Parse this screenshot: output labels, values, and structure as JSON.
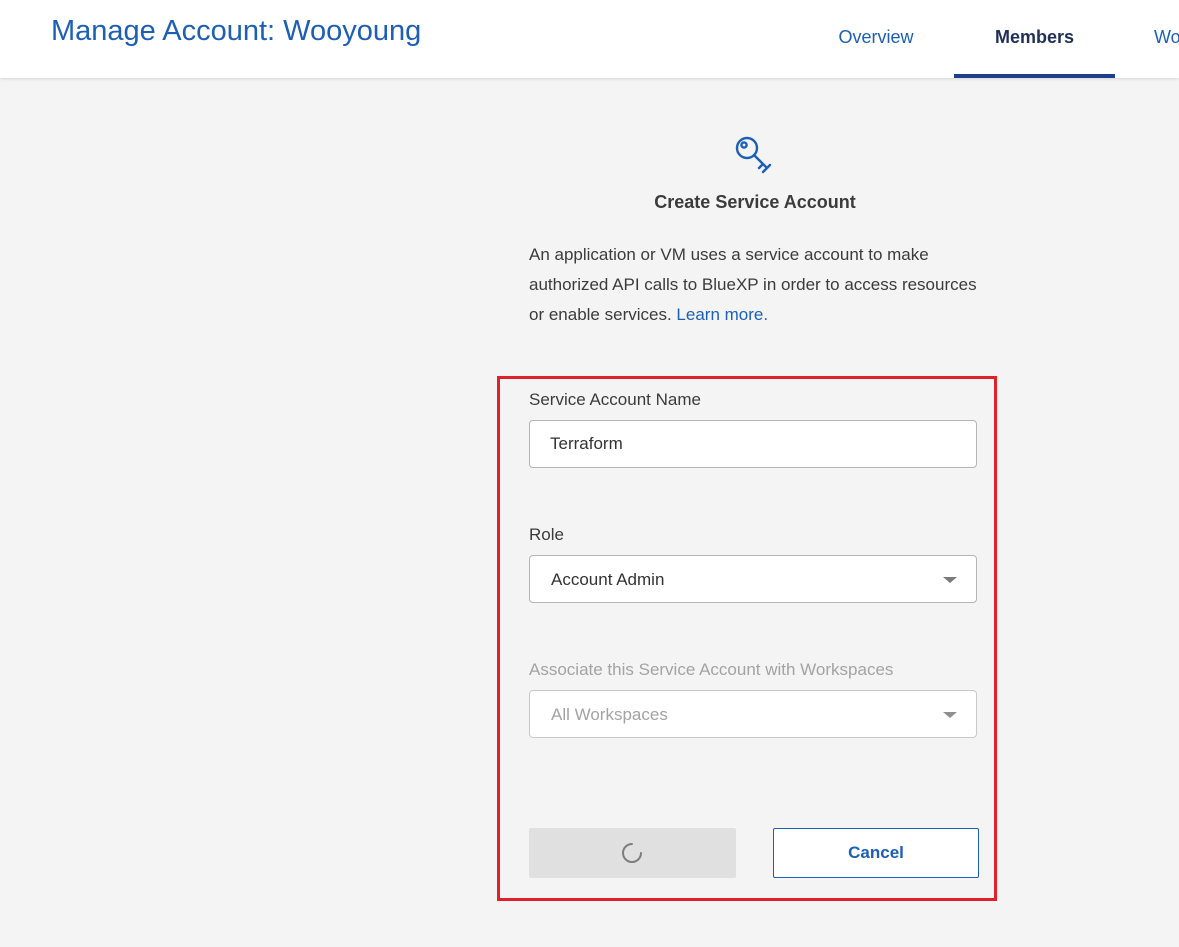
{
  "header": {
    "title": "Manage Account: Wooyoung",
    "tabs": [
      {
        "label": "Overview",
        "active": false
      },
      {
        "label": "Members",
        "active": true
      },
      {
        "label": "Wo",
        "active": false
      }
    ]
  },
  "form": {
    "icon": "key-icon",
    "title": "Create Service Account",
    "description": "An application or VM uses a service account to make authorized API calls to BlueXP in order to access resources or enable services.",
    "learn_more": "Learn more.",
    "fields": {
      "name": {
        "label": "Service Account Name",
        "value": "Terraform"
      },
      "role": {
        "label": "Role",
        "value": "Account Admin"
      },
      "workspaces": {
        "label": "Associate this Service Account with Workspaces",
        "value": "All Workspaces",
        "disabled": true
      }
    },
    "buttons": {
      "submit": {
        "state": "loading",
        "icon": "loading-spinner-icon"
      },
      "cancel": "Cancel"
    }
  },
  "colors": {
    "brand_blue": "#1c5fb5",
    "active_tab": "#1f2f57",
    "highlight_border": "#e0202a",
    "background": "#f4f4f4"
  }
}
